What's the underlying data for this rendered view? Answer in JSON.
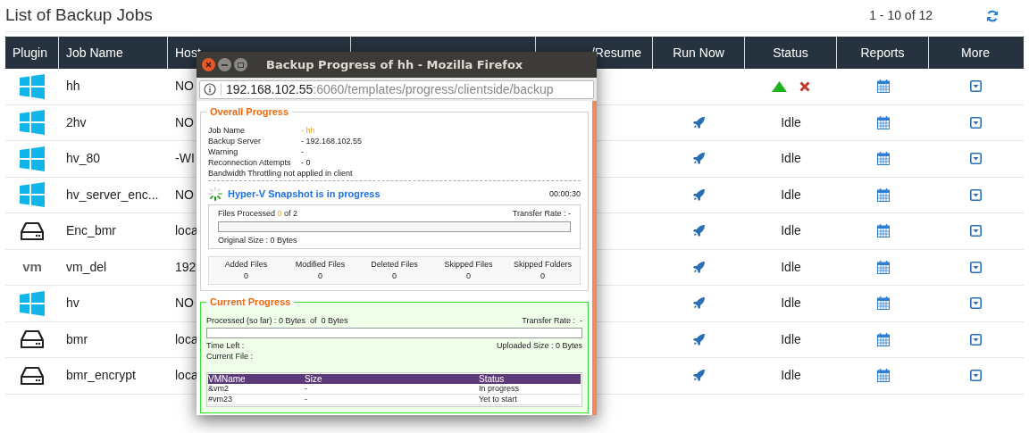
{
  "page_title": "List of Backup Jobs",
  "pagination": "1 - 10 of 12",
  "columns": [
    "Plugin",
    "Job Name",
    "Host",
    "/Resume",
    "Run Now",
    "Status",
    "Reports",
    "More"
  ],
  "rows": [
    {
      "kind": "windows",
      "name": "hh",
      "host": "NO",
      "run_now": false,
      "status": {
        "kind": "controls"
      }
    },
    {
      "kind": "windows",
      "name": "2hv",
      "host": "NO",
      "run_now": true,
      "status": {
        "kind": "text",
        "text": "Idle"
      }
    },
    {
      "kind": "windows",
      "name": "hv_80",
      "host": "-WI",
      "run_now": true,
      "status": {
        "kind": "text",
        "text": "Idle"
      }
    },
    {
      "kind": "windows",
      "name": "hv_server_enc...",
      "host": "NO",
      "run_now": true,
      "status": {
        "kind": "text",
        "text": "Idle"
      }
    },
    {
      "kind": "disk",
      "name": "Enc_bmr",
      "host": "loca",
      "run_now": true,
      "status": {
        "kind": "text",
        "text": "Idle"
      }
    },
    {
      "kind": "vm",
      "logo_text": "vm",
      "name": "vm_del",
      "host": "192",
      "run_now": true,
      "status": {
        "kind": "text",
        "text": "Idle"
      }
    },
    {
      "kind": "windows",
      "name": "hv",
      "host": "NO",
      "run_now": true,
      "status": {
        "kind": "text",
        "text": "Idle"
      }
    },
    {
      "kind": "disk",
      "name": "bmr",
      "host": "loca",
      "run_now": true,
      "status": {
        "kind": "text",
        "text": "Idle"
      }
    },
    {
      "kind": "disk",
      "name": "bmr_encrypt",
      "host": "loca",
      "run_now": true,
      "status": {
        "kind": "text",
        "text": "Idle"
      }
    }
  ],
  "popup": {
    "title": "Backup Progress of hh - Mozilla Firefox",
    "url_host": "192.168.102.55",
    "url_rest": ":6060/templates/progress/clientside/backup",
    "overall": {
      "legend": "Overall Progress",
      "fields": [
        {
          "label": "Job Name",
          "value": "- hh",
          "highlight": true
        },
        {
          "label": "Backup Server",
          "value": "- 192.168.102.55",
          "highlight": false
        },
        {
          "label": "Warning",
          "value": "-",
          "highlight": false
        },
        {
          "label": "Reconnection Attempts",
          "value": "- 0",
          "highlight": false
        }
      ],
      "note": "Bandwidth Throttling not applied in client",
      "phase": "Hyper-V Snapshot is in progress",
      "elapsed": "00:00:30",
      "files_processed": "Files Processed **0** of 2",
      "transfer_rate": "Transfer Rate : -",
      "level": 0,
      "original_size": "Original Size : 0 Bytes",
      "stats": [
        {
          "label": "Added Files",
          "value": "0"
        },
        {
          "label": "Modified Files",
          "value": "0"
        },
        {
          "label": "Deleted Files",
          "value": "0"
        },
        {
          "label": "Skipped Files",
          "value": "0"
        },
        {
          "label": "Skipped Folders",
          "value": "0"
        }
      ]
    },
    "current": {
      "legend": "Current Progress",
      "processed": "Processed (so far) : 0 Bytes  of  0 Bytes",
      "transfer_rate": "Transfer Rate :  -",
      "level": 0,
      "time_left": "Time Left :",
      "uploaded": "Uploaded Size : 0 Bytes",
      "current_file": "Current File :",
      "columns": [
        "VMName",
        "Size",
        "Status"
      ],
      "rows": [
        [
          "&vm2",
          "-",
          "In progress"
        ],
        [
          "#vm23",
          "-",
          "Yet to start"
        ]
      ]
    }
  }
}
